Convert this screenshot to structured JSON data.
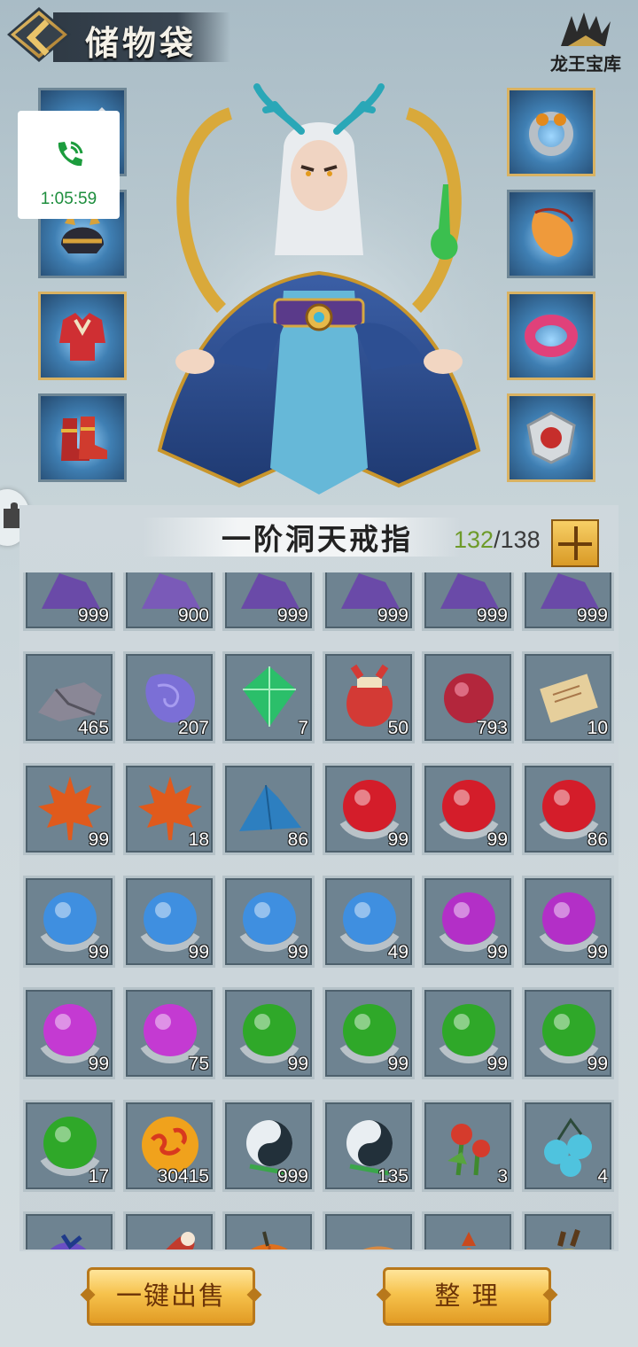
{
  "header": {
    "title": "储物袋",
    "brand": "龙王宝库"
  },
  "call": {
    "duration": "1:05:59",
    "color": "#1c8d3c"
  },
  "equipment": {
    "left": [
      "weapon-sword-icon",
      "helmet-icon",
      "armor-robe-icon",
      "boots-icon"
    ],
    "right": [
      "ring-icon",
      "amulet-icon",
      "bracelet-icon",
      "talisman-icon"
    ]
  },
  "bag": {
    "ring_name": "一阶洞天戒指",
    "capacity_used": "132",
    "capacity_total": "/138",
    "items": [
      {
        "icon": "crystal-icon",
        "color": "#6a4aa8",
        "count": "999"
      },
      {
        "icon": "crystal-icon",
        "color": "#7a5ab8",
        "count": "900"
      },
      {
        "icon": "crystal-icon",
        "color": "#6a4aa8",
        "count": "999"
      },
      {
        "icon": "crystal-icon",
        "color": "#6a4aa8",
        "count": "999"
      },
      {
        "icon": "crystal-icon",
        "color": "#6a4aa8",
        "count": "999"
      },
      {
        "icon": "crystal-icon",
        "color": "#6a4aa8",
        "count": "999"
      },
      {
        "icon": "ore-stone-icon",
        "color": "#8a8796",
        "count": "465"
      },
      {
        "icon": "purple-gem-icon",
        "color": "#7b6fd6",
        "count": "207"
      },
      {
        "icon": "emerald-icon",
        "color": "#2bbf6a",
        "count": "7"
      },
      {
        "icon": "red-pouch-icon",
        "color": "#d33a35",
        "count": "50"
      },
      {
        "icon": "red-pearl-icon",
        "color": "#b3263c",
        "count": "793"
      },
      {
        "icon": "scroll-icon",
        "color": "#e6cf9c",
        "count": "10"
      },
      {
        "icon": "maple-leaf-icon",
        "color": "#e05a1c",
        "count": "99"
      },
      {
        "icon": "maple-leaf-icon",
        "color": "#e05a1c",
        "count": "18"
      },
      {
        "icon": "blue-sand-icon",
        "color": "#2d7fc0",
        "count": "86"
      },
      {
        "icon": "red-orb-icon",
        "color": "#d41d2a",
        "count": "99"
      },
      {
        "icon": "red-orb-icon",
        "color": "#d41d2a",
        "count": "99"
      },
      {
        "icon": "red-orb-icon",
        "color": "#d41d2a",
        "count": "86"
      },
      {
        "icon": "blue-orb-icon",
        "color": "#3f8fe0",
        "count": "99"
      },
      {
        "icon": "blue-orb-icon",
        "color": "#3f8fe0",
        "count": "99"
      },
      {
        "icon": "blue-orb-icon",
        "color": "#3f8fe0",
        "count": "99"
      },
      {
        "icon": "blue-orb-icon",
        "color": "#3f8fe0",
        "count": "49"
      },
      {
        "icon": "purple-orb-icon",
        "color": "#b32fc7",
        "count": "99"
      },
      {
        "icon": "purple-orb-icon",
        "color": "#b32fc7",
        "count": "99"
      },
      {
        "icon": "purple-orb-icon",
        "color": "#c43ad2",
        "count": "99"
      },
      {
        "icon": "purple-orb-icon",
        "color": "#c43ad2",
        "count": "75"
      },
      {
        "icon": "green-orb-icon",
        "color": "#2fa829",
        "count": "99"
      },
      {
        "icon": "green-orb-icon",
        "color": "#2fa829",
        "count": "99"
      },
      {
        "icon": "green-orb-icon",
        "color": "#2fa829",
        "count": "99"
      },
      {
        "icon": "green-orb-icon",
        "color": "#2fa829",
        "count": "99"
      },
      {
        "icon": "green-orb-icon",
        "color": "#2fa829",
        "count": "17"
      },
      {
        "icon": "fire-cloud-orb-icon",
        "color": "#f0a21c",
        "count": "30415"
      },
      {
        "icon": "yin-yang-icon",
        "color": "#22303a",
        "count": "999"
      },
      {
        "icon": "yin-yang-icon",
        "color": "#22303a",
        "count": "135"
      },
      {
        "icon": "red-flower-icon",
        "color": "#d53b2c",
        "count": "3"
      },
      {
        "icon": "blue-berries-icon",
        "color": "#4fc3de",
        "count": "4"
      },
      {
        "icon": "purple-fruit-icon",
        "color": "#6a4fc4",
        "count": ""
      },
      {
        "icon": "meat-leg-icon",
        "color": "#c23b2d",
        "count": ""
      },
      {
        "icon": "pumpkin-icon",
        "color": "#e0701c",
        "count": ""
      },
      {
        "icon": "sweet-potato-icon",
        "color": "#d68a44",
        "count": ""
      },
      {
        "icon": "orange-bud-icon",
        "color": "#e2642a",
        "count": ""
      },
      {
        "icon": "yellow-pepper-icon",
        "color": "#e8c22b",
        "count": ""
      }
    ]
  },
  "buttons": {
    "sell_all": "一键出售",
    "organize": "整 理"
  }
}
